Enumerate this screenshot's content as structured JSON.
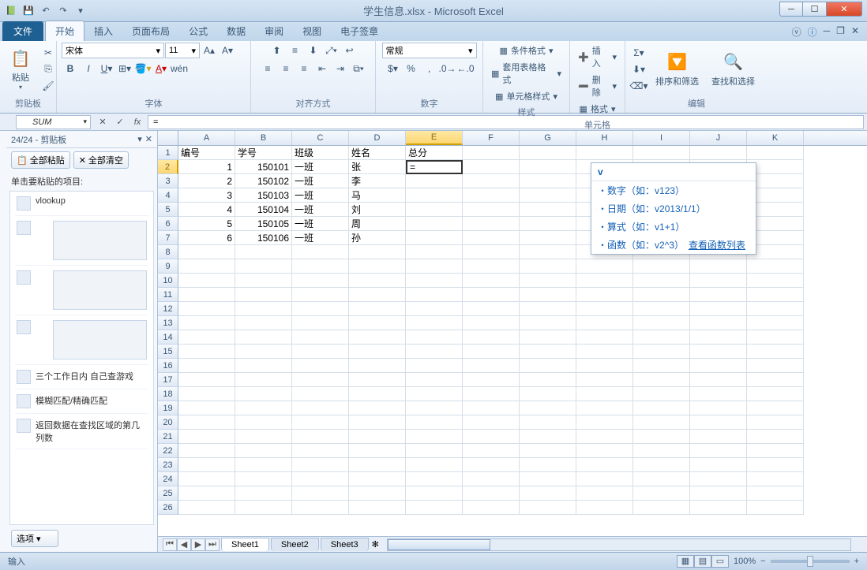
{
  "title": "学生信息.xlsx - Microsoft Excel",
  "tabs": {
    "file": "文件",
    "home": "开始",
    "insert": "插入",
    "layout": "页面布局",
    "formulas": "公式",
    "data": "数据",
    "review": "审阅",
    "view": "视图",
    "esign": "电子签章"
  },
  "ribbon": {
    "clipboard": {
      "label": "剪贴板",
      "paste": "粘贴"
    },
    "font": {
      "label": "字体",
      "name": "宋体",
      "size": "11"
    },
    "align": {
      "label": "对齐方式"
    },
    "number": {
      "label": "数字",
      "format": "常规"
    },
    "styles": {
      "label": "样式",
      "cond": "条件格式",
      "fmt": "套用表格格式",
      "cell": "单元格样式"
    },
    "cells": {
      "label": "单元格",
      "insert": "插入",
      "delete": "删除",
      "format": "格式"
    },
    "editing": {
      "label": "编辑",
      "sort": "排序和筛选",
      "find": "查找和选择"
    }
  },
  "formula": {
    "name": "SUM",
    "value": "="
  },
  "sidebar": {
    "title": "剪贴板",
    "count": "24/24",
    "pasteall": "全部粘贴",
    "clearall": "全部清空",
    "instruction": "单击要粘贴的项目:",
    "clips": [
      "vlookup",
      "",
      "",
      "",
      "三个工作日内 自己查游戏",
      "模糊匹配/精确匹配",
      "返回数据在查找区域的第几列数"
    ],
    "options": "选项"
  },
  "columns": [
    "A",
    "B",
    "C",
    "D",
    "E",
    "F",
    "G",
    "H",
    "I",
    "J",
    "K"
  ],
  "headers": [
    "编号",
    "学号",
    "班级",
    "姓名",
    "总分"
  ],
  "data": [
    [
      "1",
      "150101",
      "一班",
      "张",
      "="
    ],
    [
      "2",
      "150102",
      "一班",
      "李",
      ""
    ],
    [
      "3",
      "150103",
      "一班",
      "马",
      ""
    ],
    [
      "4",
      "150104",
      "一班",
      "刘",
      ""
    ],
    [
      "5",
      "150105",
      "一班",
      "周",
      ""
    ],
    [
      "6",
      "150106",
      "一班",
      "孙",
      ""
    ]
  ],
  "ime": {
    "input": "v",
    "rows": [
      "数字（如：v123）",
      "日期（如：v2013/1/1）",
      "算式（如：v1+1）",
      "函数（如：v2^3）"
    ],
    "link": "查看函数列表"
  },
  "sheets": [
    "Sheet1",
    "Sheet2",
    "Sheet3"
  ],
  "status": {
    "mode": "输入",
    "zoom": "100%"
  }
}
